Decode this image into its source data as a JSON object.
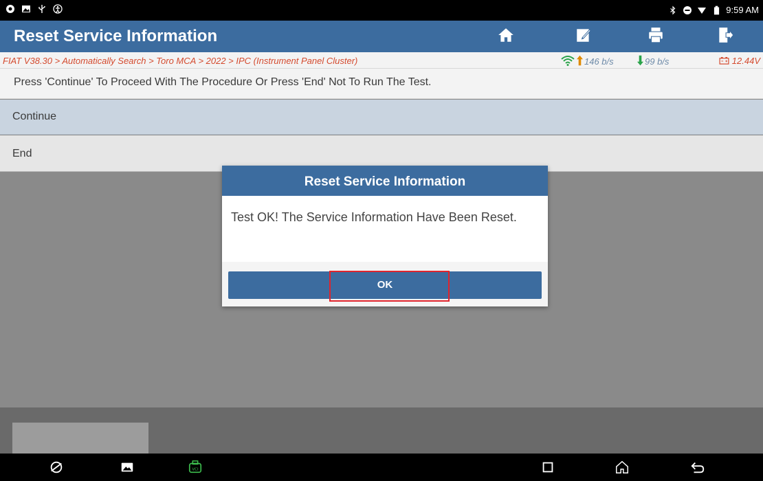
{
  "status_bar": {
    "time": "9:59 AM",
    "left_icons": [
      "record-icon",
      "gallery-icon",
      "usb-icon",
      "accessibility-icon"
    ],
    "right_icons": [
      "bluetooth-icon",
      "do-not-disturb-icon",
      "wifi-icon",
      "battery-icon"
    ]
  },
  "header": {
    "title": "Reset Service Information",
    "buttons": [
      "home-icon",
      "edit-icon",
      "print-icon",
      "exit-icon"
    ]
  },
  "breadcrumb": {
    "path": "FIAT V38.30 > Automatically Search > Toro MCA > 2022 > IPC (Instrument Panel Cluster)",
    "upload": "146 b/s",
    "download": "99 b/s",
    "voltage": "12.44V"
  },
  "main": {
    "instruction": "Press 'Continue' To Proceed With The Procedure Or Press 'End' Not To Run The Test.",
    "options": [
      "Continue",
      "End"
    ]
  },
  "dialog": {
    "title": "Reset Service Information",
    "message": "Test OK! The Service Information Have Been Reset.",
    "ok_label": "OK"
  },
  "nav_bar": {
    "icons": [
      "browser-icon",
      "gallery-icon",
      "vci-icon",
      "recents-icon",
      "home-icon",
      "back-icon"
    ]
  },
  "colors": {
    "accent": "#3c6c9f",
    "breadcrumb_text": "#d44a2e",
    "highlight": "#e0242c",
    "selected_row": "#c9d4e0"
  }
}
